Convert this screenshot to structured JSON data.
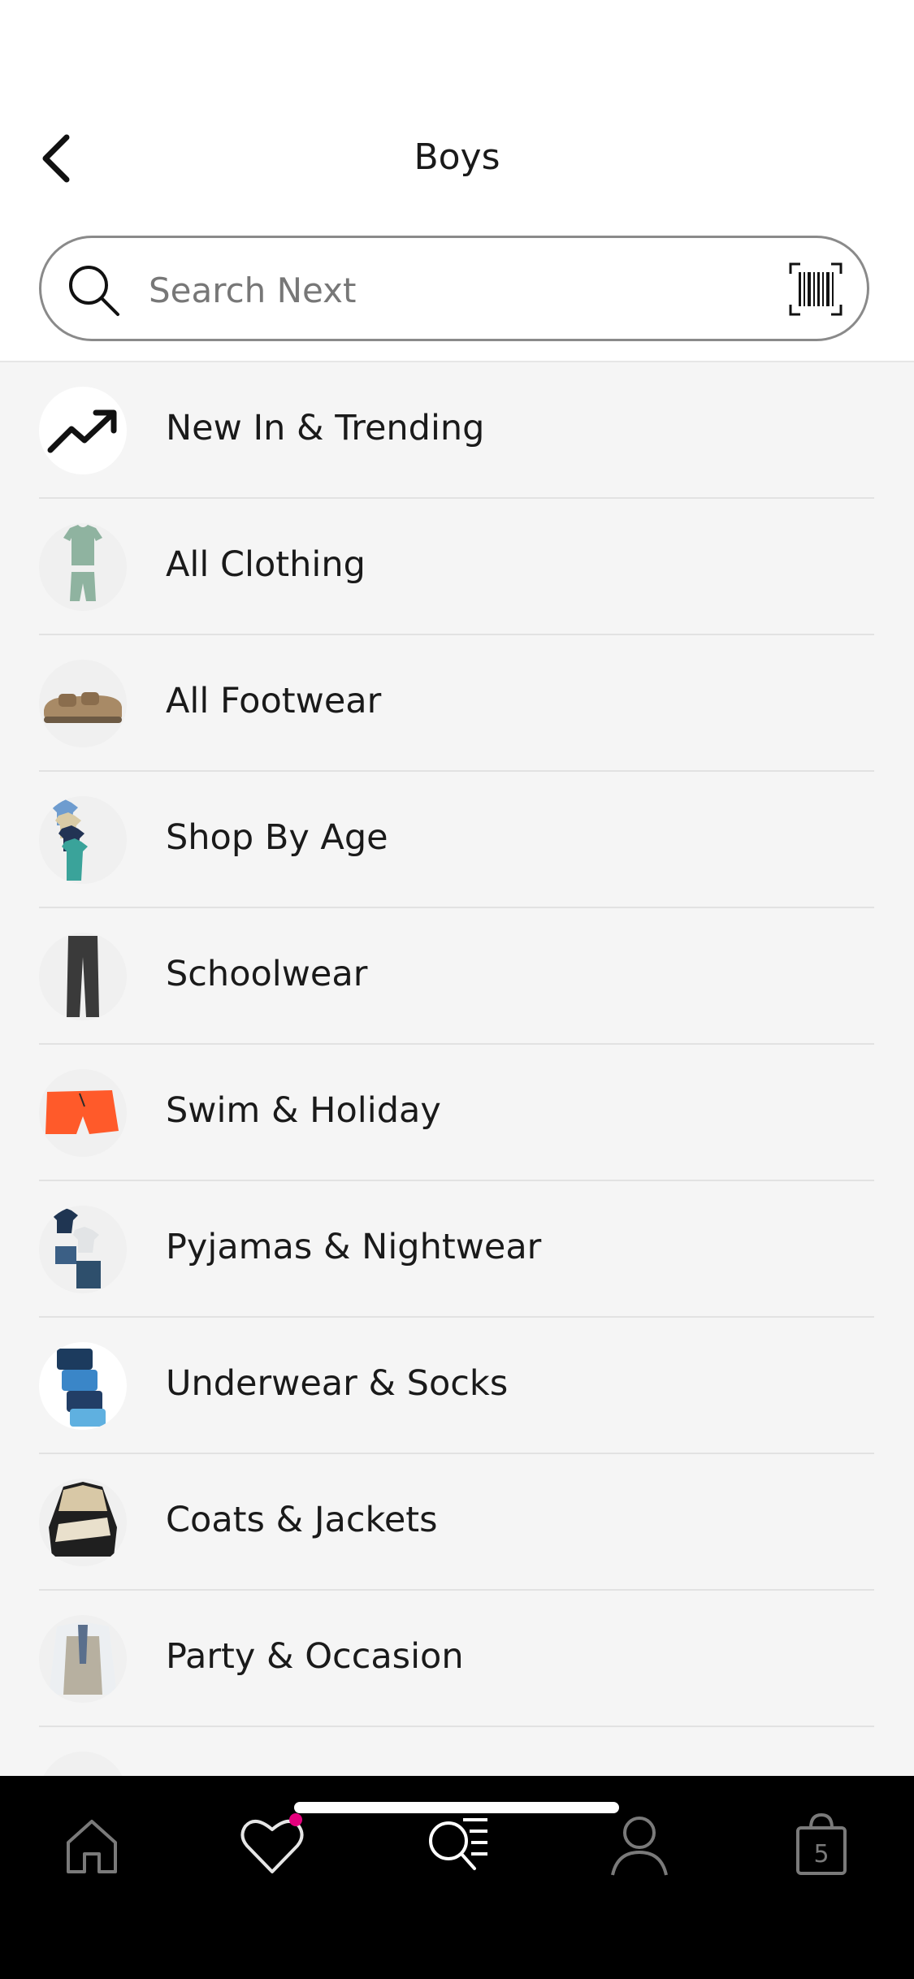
{
  "header": {
    "title": "Boys"
  },
  "search": {
    "placeholder": "Search Next"
  },
  "categories": [
    {
      "label": "New In & Trending"
    },
    {
      "label": "All Clothing"
    },
    {
      "label": "All Footwear"
    },
    {
      "label": "Shop By Age"
    },
    {
      "label": "Schoolwear"
    },
    {
      "label": "Swim & Holiday"
    },
    {
      "label": "Pyjamas & Nightwear"
    },
    {
      "label": "Underwear & Socks"
    },
    {
      "label": "Coats & Jackets"
    },
    {
      "label": "Party & Occasion"
    }
  ],
  "tabbar": {
    "tabs": [
      {
        "name": "home",
        "icon": "home-icon"
      },
      {
        "name": "favourites",
        "icon": "heart-icon"
      },
      {
        "name": "shop",
        "icon": "search-menu-icon"
      },
      {
        "name": "account",
        "icon": "person-icon"
      },
      {
        "name": "bag",
        "icon": "bag-icon"
      }
    ],
    "bag_count": "5",
    "notification_dot_color": "#e6007e"
  },
  "colors": {
    "accent": "#e6007e",
    "tabbar_bg": "#000000",
    "list_bg": "#f5f5f5"
  }
}
